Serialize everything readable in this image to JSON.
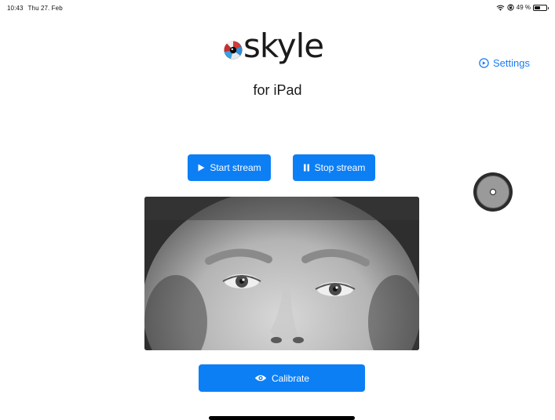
{
  "status_bar": {
    "time": "10:43",
    "date": "Thu 27. Feb",
    "battery_text": "49 %",
    "battery_level": 0.49,
    "icons": [
      "wifi-icon",
      "orientation-lock-icon",
      "battery-icon"
    ]
  },
  "header": {
    "logo_text": "skyle",
    "subtitle": "for iPad"
  },
  "settings": {
    "label": "Settings",
    "icon": "settings-icon"
  },
  "controls": {
    "start_label": "Start stream",
    "stop_label": "Stop stream",
    "calibrate_label": "Calibrate",
    "start_icon": "play-icon",
    "stop_icon": "pause-icon",
    "calibrate_icon": "eye-icon"
  },
  "video": {
    "description_icon": "camera-feed"
  },
  "colors": {
    "accent": "#0d7ff5",
    "link": "#1a7cf0",
    "background": "#ffffff"
  }
}
